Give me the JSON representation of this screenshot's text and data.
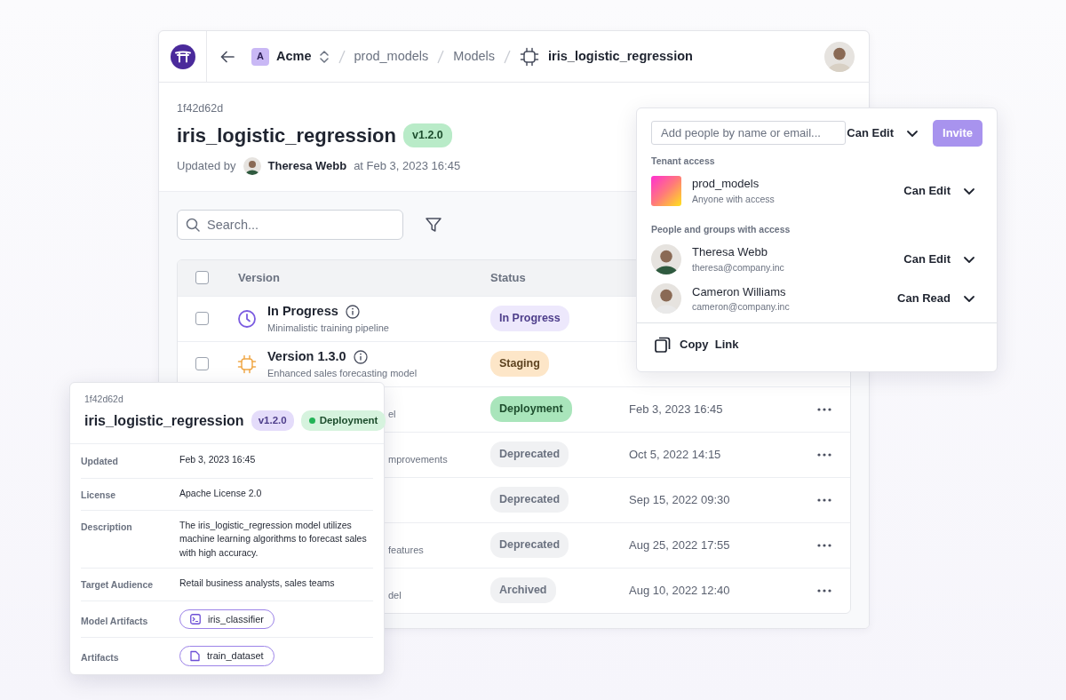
{
  "header": {
    "workspace_initial": "A",
    "workspace": "Acme",
    "breadcrumbs": [
      "prod_models",
      "Models"
    ],
    "current": "iris_logistic_regression"
  },
  "model": {
    "id": "1f42d62d",
    "name": "iris_logistic_regression",
    "version": "v1.2.0",
    "updated_label": "Updated by",
    "updated_by": "Theresa Webb",
    "updated_at": "at Feb 3, 2023 16:45"
  },
  "search": {
    "placeholder": "Search..."
  },
  "table": {
    "columns": [
      "Version",
      "Status"
    ],
    "all_checked": false,
    "rows": [
      {
        "kind": "clock",
        "checked": false,
        "title": "In Progress",
        "subtitle": "Minimalistic training pipeline",
        "status": "In Progress",
        "color": "#ede8fc"
      },
      {
        "kind": "chip",
        "checked": false,
        "title": "Version 1.3.0",
        "subtitle": "Enhanced sales forecasting model",
        "status": "Staging",
        "color": "#fde6c8"
      },
      {
        "kind": "covered",
        "subtitle": "el",
        "status": "Deployment",
        "color": "#a9e5bb",
        "date": "Feb 3, 2023 16:45"
      },
      {
        "kind": "covered",
        "subtitle": "mprovements",
        "status": "Deprecated",
        "color": "#f0f1f3",
        "date": "Oct 5, 2022 14:15"
      },
      {
        "kind": "covered",
        "status": "Deprecated",
        "color": "#f0f1f3",
        "date": "Sep 15, 2022 09:30"
      },
      {
        "kind": "covered",
        "subtitle": "features",
        "status": "Deprecated",
        "color": "#f0f1f3",
        "date": "Aug 25, 2022 17:55"
      },
      {
        "kind": "covered",
        "subtitle": "del",
        "status": "Archived",
        "color": "#f0f1f3",
        "date": "Aug 10, 2022 12:40"
      }
    ]
  },
  "share": {
    "invite_placeholder": "Add people by name or email...",
    "invite_permission": "Can Edit",
    "invite_button": "Invite",
    "invite_disabled": true,
    "sections": [
      {
        "title": "Tenant access",
        "entries": [
          {
            "kind": "tenant",
            "name": "prod_models",
            "detail": "Anyone with access",
            "permission": "Can Edit"
          }
        ]
      },
      {
        "title": "People and groups with access",
        "entries": [
          {
            "kind": "person",
            "name": "Theresa Webb",
            "detail": "theresa@company.inc",
            "permission": "Can Edit"
          },
          {
            "kind": "person",
            "name": "Cameron Williams",
            "detail": "cameron@company.inc",
            "permission": "Can Read"
          }
        ]
      }
    ],
    "copy_link": "Copy  Link"
  },
  "details": {
    "id": "1f42d62d",
    "name": "iris_logistic_regression",
    "version": "v1.2.0",
    "status": "Deployment",
    "fields": [
      {
        "label": "Updated",
        "kind": "text",
        "value": "Feb 3, 2023 16:45"
      },
      {
        "label": "License",
        "kind": "text",
        "value": "Apache License 2.0"
      },
      {
        "label": "Description",
        "kind": "text",
        "value": "The iris_logistic_regression model utilizes machine learning algorithms to forecast sales with high accuracy."
      },
      {
        "label": "Target Audience",
        "kind": "text",
        "value": "Retail business analysts, sales teams"
      },
      {
        "label": "Model Artifacts",
        "kind": "model-artifact",
        "value": "iris_classifier"
      },
      {
        "label": "Artifacts",
        "kind": "file-artifact",
        "value": "train_dataset"
      }
    ]
  }
}
